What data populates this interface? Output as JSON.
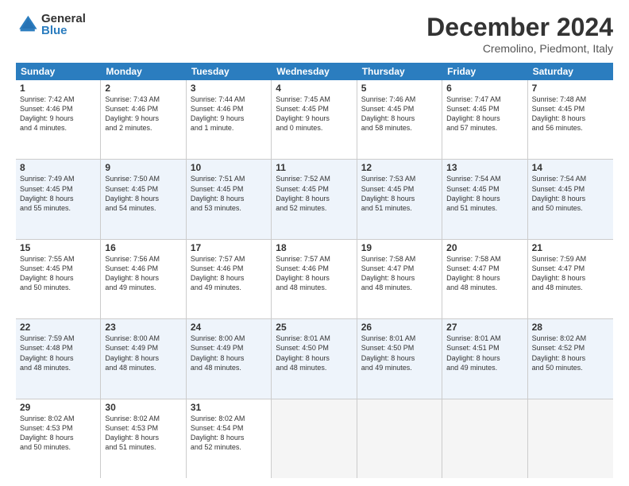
{
  "header": {
    "logo_general": "General",
    "logo_blue": "Blue",
    "month_title": "December 2024",
    "location": "Cremolino, Piedmont, Italy"
  },
  "days_of_week": [
    "Sunday",
    "Monday",
    "Tuesday",
    "Wednesday",
    "Thursday",
    "Friday",
    "Saturday"
  ],
  "weeks": [
    [
      {
        "day": "1",
        "info": "Sunrise: 7:42 AM\nSunset: 4:46 PM\nDaylight: 9 hours\nand 4 minutes."
      },
      {
        "day": "2",
        "info": "Sunrise: 7:43 AM\nSunset: 4:46 PM\nDaylight: 9 hours\nand 2 minutes."
      },
      {
        "day": "3",
        "info": "Sunrise: 7:44 AM\nSunset: 4:46 PM\nDaylight: 9 hours\nand 1 minute."
      },
      {
        "day": "4",
        "info": "Sunrise: 7:45 AM\nSunset: 4:45 PM\nDaylight: 9 hours\nand 0 minutes."
      },
      {
        "day": "5",
        "info": "Sunrise: 7:46 AM\nSunset: 4:45 PM\nDaylight: 8 hours\nand 58 minutes."
      },
      {
        "day": "6",
        "info": "Sunrise: 7:47 AM\nSunset: 4:45 PM\nDaylight: 8 hours\nand 57 minutes."
      },
      {
        "day": "7",
        "info": "Sunrise: 7:48 AM\nSunset: 4:45 PM\nDaylight: 8 hours\nand 56 minutes."
      }
    ],
    [
      {
        "day": "8",
        "info": "Sunrise: 7:49 AM\nSunset: 4:45 PM\nDaylight: 8 hours\nand 55 minutes."
      },
      {
        "day": "9",
        "info": "Sunrise: 7:50 AM\nSunset: 4:45 PM\nDaylight: 8 hours\nand 54 minutes."
      },
      {
        "day": "10",
        "info": "Sunrise: 7:51 AM\nSunset: 4:45 PM\nDaylight: 8 hours\nand 53 minutes."
      },
      {
        "day": "11",
        "info": "Sunrise: 7:52 AM\nSunset: 4:45 PM\nDaylight: 8 hours\nand 52 minutes."
      },
      {
        "day": "12",
        "info": "Sunrise: 7:53 AM\nSunset: 4:45 PM\nDaylight: 8 hours\nand 51 minutes."
      },
      {
        "day": "13",
        "info": "Sunrise: 7:54 AM\nSunset: 4:45 PM\nDaylight: 8 hours\nand 51 minutes."
      },
      {
        "day": "14",
        "info": "Sunrise: 7:54 AM\nSunset: 4:45 PM\nDaylight: 8 hours\nand 50 minutes."
      }
    ],
    [
      {
        "day": "15",
        "info": "Sunrise: 7:55 AM\nSunset: 4:45 PM\nDaylight: 8 hours\nand 50 minutes."
      },
      {
        "day": "16",
        "info": "Sunrise: 7:56 AM\nSunset: 4:46 PM\nDaylight: 8 hours\nand 49 minutes."
      },
      {
        "day": "17",
        "info": "Sunrise: 7:57 AM\nSunset: 4:46 PM\nDaylight: 8 hours\nand 49 minutes."
      },
      {
        "day": "18",
        "info": "Sunrise: 7:57 AM\nSunset: 4:46 PM\nDaylight: 8 hours\nand 48 minutes."
      },
      {
        "day": "19",
        "info": "Sunrise: 7:58 AM\nSunset: 4:47 PM\nDaylight: 8 hours\nand 48 minutes."
      },
      {
        "day": "20",
        "info": "Sunrise: 7:58 AM\nSunset: 4:47 PM\nDaylight: 8 hours\nand 48 minutes."
      },
      {
        "day": "21",
        "info": "Sunrise: 7:59 AM\nSunset: 4:47 PM\nDaylight: 8 hours\nand 48 minutes."
      }
    ],
    [
      {
        "day": "22",
        "info": "Sunrise: 7:59 AM\nSunset: 4:48 PM\nDaylight: 8 hours\nand 48 minutes."
      },
      {
        "day": "23",
        "info": "Sunrise: 8:00 AM\nSunset: 4:49 PM\nDaylight: 8 hours\nand 48 minutes."
      },
      {
        "day": "24",
        "info": "Sunrise: 8:00 AM\nSunset: 4:49 PM\nDaylight: 8 hours\nand 48 minutes."
      },
      {
        "day": "25",
        "info": "Sunrise: 8:01 AM\nSunset: 4:50 PM\nDaylight: 8 hours\nand 48 minutes."
      },
      {
        "day": "26",
        "info": "Sunrise: 8:01 AM\nSunset: 4:50 PM\nDaylight: 8 hours\nand 49 minutes."
      },
      {
        "day": "27",
        "info": "Sunrise: 8:01 AM\nSunset: 4:51 PM\nDaylight: 8 hours\nand 49 minutes."
      },
      {
        "day": "28",
        "info": "Sunrise: 8:02 AM\nSunset: 4:52 PM\nDaylight: 8 hours\nand 50 minutes."
      }
    ],
    [
      {
        "day": "29",
        "info": "Sunrise: 8:02 AM\nSunset: 4:53 PM\nDaylight: 8 hours\nand 50 minutes."
      },
      {
        "day": "30",
        "info": "Sunrise: 8:02 AM\nSunset: 4:53 PM\nDaylight: 8 hours\nand 51 minutes."
      },
      {
        "day": "31",
        "info": "Sunrise: 8:02 AM\nSunset: 4:54 PM\nDaylight: 8 hours\nand 52 minutes."
      },
      {
        "day": "",
        "info": ""
      },
      {
        "day": "",
        "info": ""
      },
      {
        "day": "",
        "info": ""
      },
      {
        "day": "",
        "info": ""
      }
    ]
  ]
}
